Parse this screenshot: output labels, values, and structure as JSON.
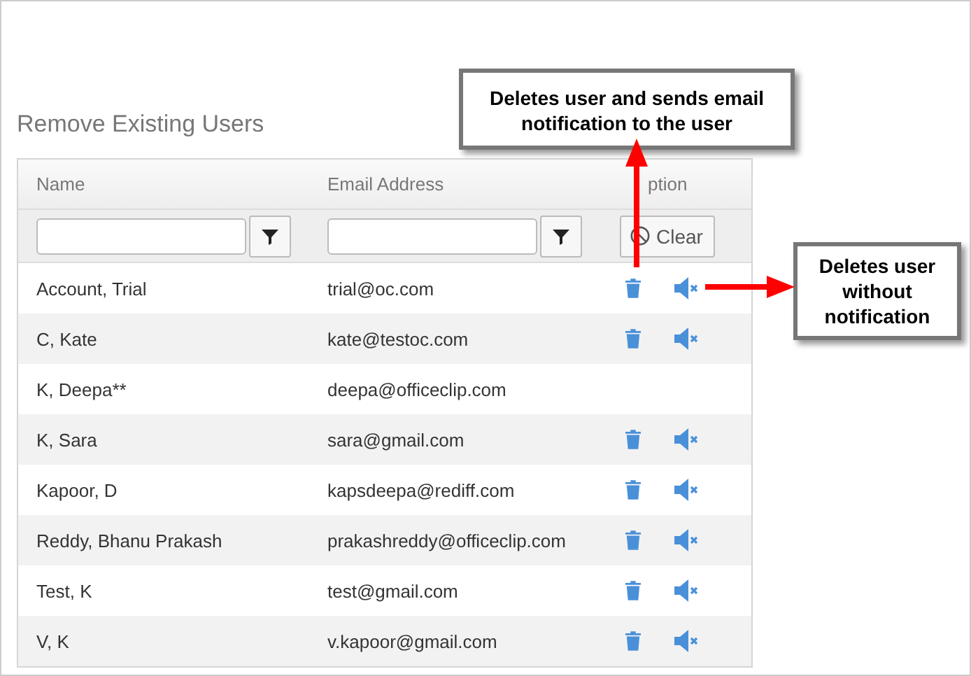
{
  "title": "Remove Existing Users",
  "table": {
    "columns": [
      "Name",
      "Email Address",
      "ption"
    ],
    "filters": [
      {
        "kind": "text"
      },
      {
        "kind": "text"
      },
      {
        "kind": "clear",
        "label": "Clear"
      }
    ],
    "rows": [
      {
        "name": "Account, Trial",
        "email": "trial@oc.com",
        "actions": true
      },
      {
        "name": "C, Kate",
        "email": "kate@testoc.com",
        "actions": true
      },
      {
        "name": "K, Deepa**",
        "email": "deepa@officeclip.com",
        "actions": false
      },
      {
        "name": "K, Sara",
        "email": "sara@gmail.com",
        "actions": true
      },
      {
        "name": "Kapoor, D",
        "email": "kapsdeepa@rediff.com",
        "actions": true
      },
      {
        "name": "Reddy, Bhanu Prakash",
        "email": "prakashreddy@officeclip.com",
        "actions": true
      },
      {
        "name": "Test, K",
        "email": "test@gmail.com",
        "actions": true
      },
      {
        "name": "V, K",
        "email": "v.kapoor@gmail.com",
        "actions": true
      }
    ]
  },
  "callouts": [
    {
      "text": "Deletes user and sends email notification to the user",
      "kind": "up"
    },
    {
      "text": "Deletes user without notification",
      "kind": "left"
    }
  ]
}
